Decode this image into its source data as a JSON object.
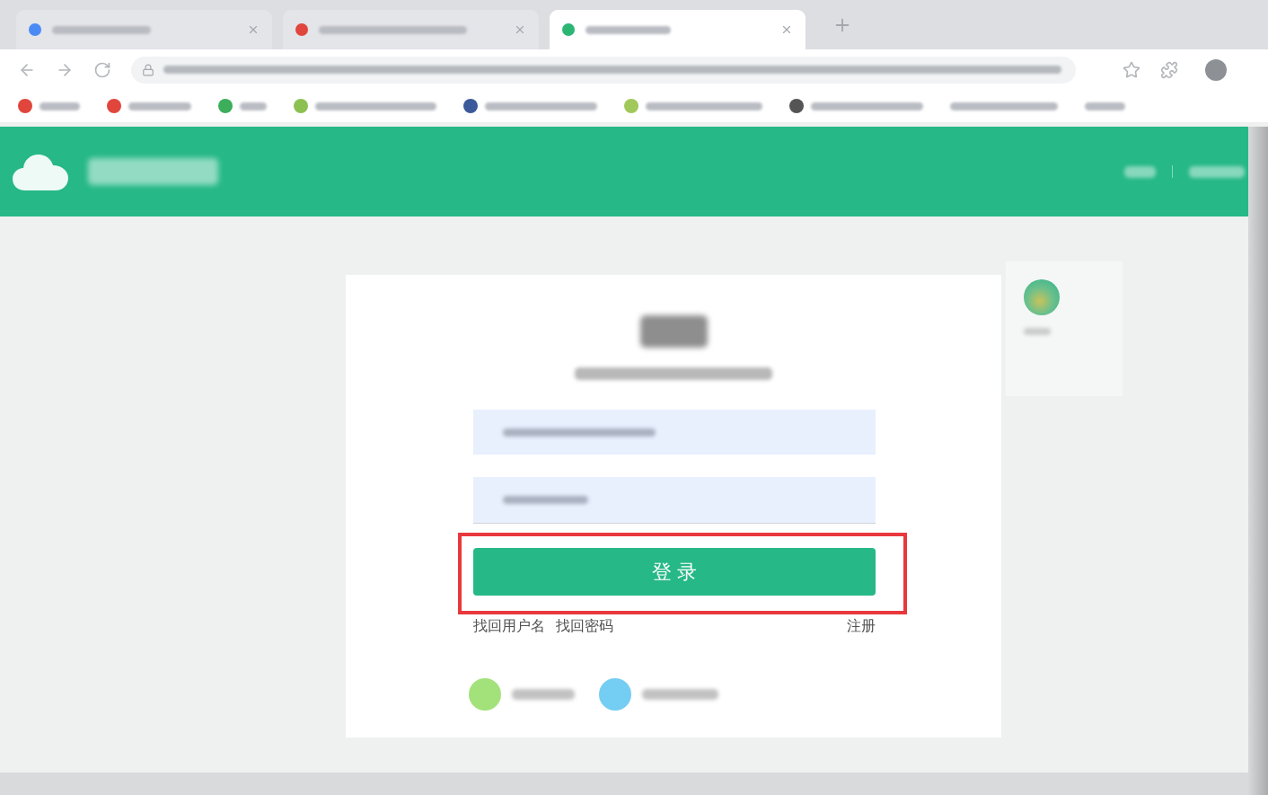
{
  "browser": {
    "tabs": [
      {
        "selected": false,
        "color": "#4a8af4"
      },
      {
        "selected": false,
        "color": "#e0463c"
      },
      {
        "selected": true,
        "color": "#2bb673"
      }
    ],
    "bookmarks": [
      {
        "color": "#e0463c"
      },
      {
        "color": "#e0463c"
      },
      {
        "color": "#3cae5c"
      },
      {
        "color": "#8cc152"
      },
      {
        "color": "#3b5a9a"
      },
      {
        "color": "#a0c85a"
      },
      {
        "color": "#555555"
      }
    ]
  },
  "login": {
    "fields": [
      {
        "filled": true
      },
      {
        "filled": true
      }
    ],
    "button": {
      "label": "登 录",
      "highlighted": true
    },
    "links": [
      {
        "label": "找回用户名"
      },
      {
        "label": "找回密码"
      }
    ],
    "register_link": {
      "label": "注册"
    },
    "social_logins": [
      {
        "color": "#a3e27b"
      },
      {
        "color": "#74cdf2"
      }
    ]
  }
}
